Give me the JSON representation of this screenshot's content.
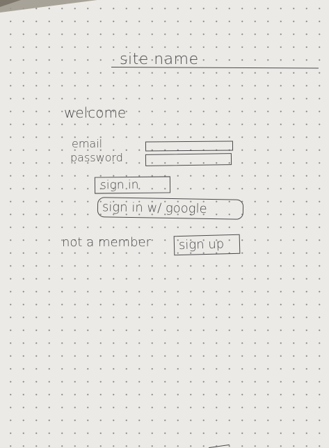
{
  "header": {
    "site_name": "site name"
  },
  "main": {
    "welcome": "welcome",
    "email_label": "email",
    "password_label": "password",
    "email_value": "",
    "password_value": "",
    "sign_in_label": "sign in",
    "google_label": "sign in w/ google",
    "not_member_text": "not a member",
    "sign_up_label": "sign up"
  },
  "colors": {
    "ink": "#4a4a4c",
    "paper": "#eceae6"
  }
}
